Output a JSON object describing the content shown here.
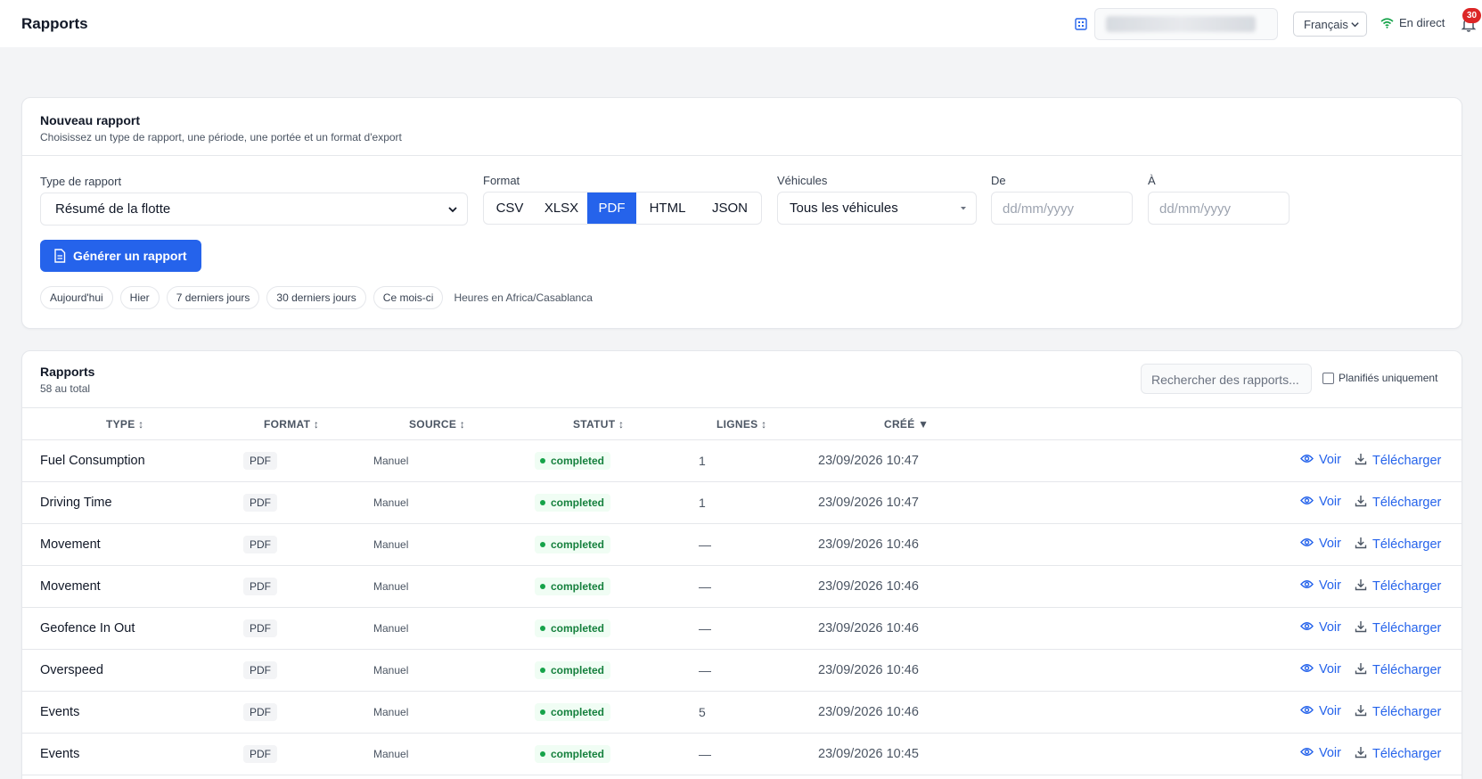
{
  "header": {
    "title": "Rapports",
    "language": "Français",
    "live_label": "En direct",
    "notification_count": "30"
  },
  "new_report": {
    "title": "Nouveau rapport",
    "subtitle": "Choisissez un type de rapport, une période, une portée et un format d'export",
    "type_label": "Type de rapport",
    "type_value": "Résumé de la flotte",
    "format_label": "Format",
    "formats": [
      "CSV",
      "XLSX",
      "PDF",
      "HTML",
      "JSON"
    ],
    "selected_format": "PDF",
    "vehicles_label": "Véhicules",
    "vehicles_value": "Tous les véhicules",
    "from_label": "De",
    "from_placeholder": "dd/mm/yyyy",
    "to_label": "À",
    "to_placeholder": "dd/mm/yyyy",
    "generate_label": "Générer un rapport",
    "quick_ranges": [
      "Aujourd'hui",
      "Hier",
      "7 derniers jours",
      "30 derniers jours",
      "Ce mois-ci"
    ],
    "timezone_note": "Heures en Africa/Casablanca"
  },
  "reports": {
    "title": "Rapports",
    "total": "58 au total",
    "search_placeholder": "Rechercher des rapports...",
    "scheduled_only_label": "Planifiés uniquement",
    "columns": {
      "type": "TYPE ↕",
      "format": "FORMAT ↕",
      "source": "SOURCE ↕",
      "status": "STATUT ↕",
      "lines": "LIGNES ↕",
      "created": "CRÉÉ ▼"
    },
    "view_label": "Voir",
    "download_label": "Télécharger",
    "rows": [
      {
        "type": "Fuel Consumption",
        "format": "PDF",
        "source": "Manuel",
        "status": "completed",
        "lines": "1",
        "created": "23/09/2026 10:47"
      },
      {
        "type": "Driving Time",
        "format": "PDF",
        "source": "Manuel",
        "status": "completed",
        "lines": "1",
        "created": "23/09/2026 10:47"
      },
      {
        "type": "Movement",
        "format": "PDF",
        "source": "Manuel",
        "status": "completed",
        "lines": "—",
        "created": "23/09/2026 10:46"
      },
      {
        "type": "Movement",
        "format": "PDF",
        "source": "Manuel",
        "status": "completed",
        "lines": "—",
        "created": "23/09/2026 10:46"
      },
      {
        "type": "Geofence In Out",
        "format": "PDF",
        "source": "Manuel",
        "status": "completed",
        "lines": "—",
        "created": "23/09/2026 10:46"
      },
      {
        "type": "Overspeed",
        "format": "PDF",
        "source": "Manuel",
        "status": "completed",
        "lines": "—",
        "created": "23/09/2026 10:46"
      },
      {
        "type": "Events",
        "format": "PDF",
        "source": "Manuel",
        "status": "completed",
        "lines": "5",
        "created": "23/09/2026 10:46"
      },
      {
        "type": "Events",
        "format": "PDF",
        "source": "Manuel",
        "status": "completed",
        "lines": "—",
        "created": "23/09/2026 10:45"
      }
    ]
  },
  "colors": {
    "primary": "#2563eb",
    "success_text": "#15803d",
    "success_bg": "#f0fdf4",
    "badge": "#dc2626"
  },
  "icons": {
    "organization": "building-icon",
    "live": "wifi-icon",
    "notifications": "bell-icon",
    "generate": "document-icon",
    "view": "eye-icon",
    "download": "download-icon"
  }
}
